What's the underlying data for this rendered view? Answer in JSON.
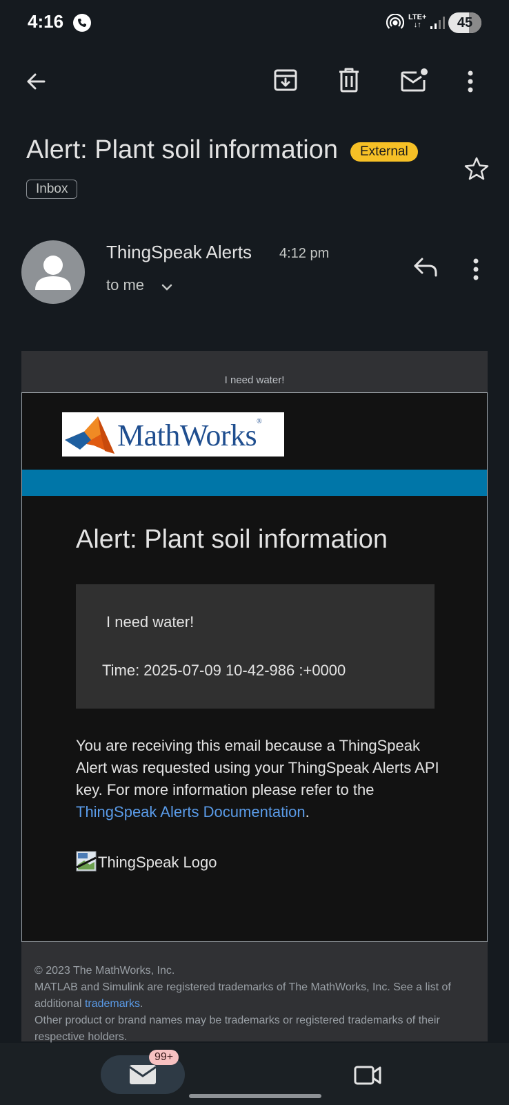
{
  "status_bar": {
    "time": "4:16",
    "network": "LTE+",
    "battery": "45"
  },
  "header": {
    "subject": "Alert: Plant soil information",
    "external_label": "External",
    "label_chip": "Inbox"
  },
  "sender": {
    "name": "ThingSpeak Alerts",
    "time": "4:12 pm",
    "to": "to me"
  },
  "email": {
    "preheader": "I need water!",
    "logo_text": "MathWorks",
    "title": "Alert: Plant soil information",
    "message": "I need water!",
    "time_line": "Time: 2025-07-09 10-42-986 :+0000",
    "para_text": "You are receiving this email because a ThingSpeak Alert was requested using your ThingSpeak Alerts API key. For more information please refer to the",
    "para_link": "ThingSpeak Alerts Documentation",
    "para_end": ".",
    "logo_alt": "ThingSpeak Logo",
    "footer": {
      "copyright": "© 2023 The MathWorks, Inc.",
      "trademark_text": "MATLAB and Simulink are registered trademarks of The MathWorks, Inc. See a list of additional",
      "trademark_link": "trademarks",
      "trademark_end": ".",
      "other": "Other product or brand names may be trademarks or registered trademarks of their respective holders."
    }
  },
  "bottom_nav": {
    "mail_badge": "99+"
  },
  "colors": {
    "background": "#151a1f",
    "external_badge": "#f6c026",
    "band": "#0076a8",
    "link": "#5a9be8"
  }
}
